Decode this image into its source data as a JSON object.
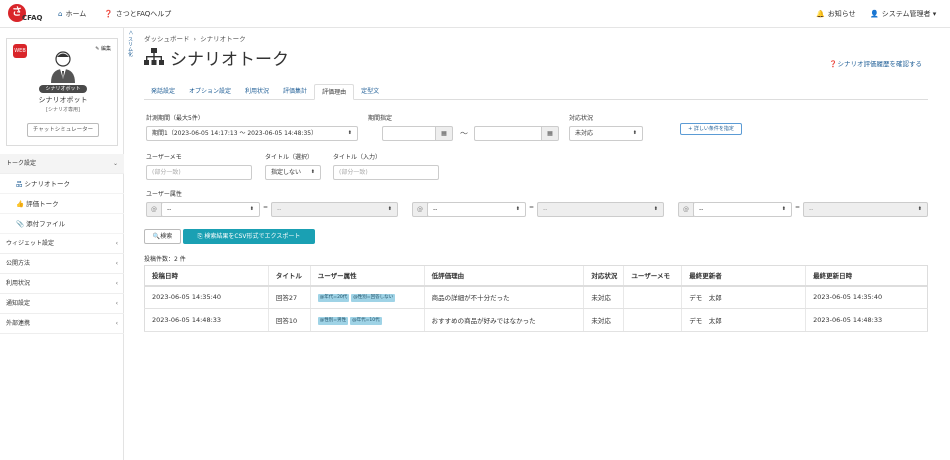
{
  "header": {
    "logo_text": "CFAQ",
    "logo_mark": "さ",
    "home_label": "ホーム",
    "help_label": "さつとFAQヘルプ",
    "notice_label": "お知らせ",
    "user_label": "システム管理者"
  },
  "sidebar": {
    "collapse_label": "＜ スリム化",
    "profile": {
      "web_badge": "WEB",
      "edit_label": "編集",
      "tag": "シナリオボット",
      "name": "シナリオボット",
      "sub": "[シナリオ専用]",
      "simulator_label": "チャットシミュレーター"
    },
    "menu": [
      {
        "label": "トーク設定",
        "open": true
      },
      {
        "label": "ウィジェット設定"
      },
      {
        "label": "公開方法"
      },
      {
        "label": "利用状況"
      },
      {
        "label": "通知設定"
      },
      {
        "label": "外部連携"
      }
    ],
    "submenu": [
      {
        "label": "シナリオトーク"
      },
      {
        "label": "評価トーク"
      },
      {
        "label": "添付ファイル"
      }
    ]
  },
  "breadcrumb": {
    "root": "ダッシュボード",
    "current": "シナリオトーク"
  },
  "page": {
    "title": "シナリオトーク",
    "history_link": "シナリオ評価履歴を確認する"
  },
  "tabs": [
    "発話設定",
    "オプション設定",
    "利用状況",
    "評価集計",
    "評価理由",
    "定型文"
  ],
  "active_tab": "評価理由",
  "filters": {
    "period_label": "計測期間（最大5件）",
    "period_value": "期間1（2023-06-05 14:17:13 〜 2023-06-05 14:48:35）",
    "range_label": "期間指定",
    "range_tilde": "〜",
    "status_label": "対応状況",
    "status_value": "未対応",
    "detail_button": "+ 詳しい条件を指定",
    "memo_label": "ユーザーメモ",
    "memo_placeholder": "(部分一致)",
    "title_select_label": "タイトル（選択）",
    "title_select_value": "指定しない",
    "title_input_label": "タイトル（入力）",
    "title_input_placeholder": "(部分一致)",
    "attr_label": "ユーザー属性",
    "attr_select_value": "--",
    "attr_eq": "=",
    "attr_value_placeholder": "--"
  },
  "actions": {
    "search_label": "検索",
    "export_label": "検索結果をCSV形式でエクスポート"
  },
  "result_count": "投稿件数：2 件",
  "table": {
    "headers": [
      "投稿日時",
      "タイトル",
      "ユーザー属性",
      "低評価理由",
      "対応状況",
      "ユーザーメモ",
      "最終更新者",
      "最終更新日時"
    ],
    "rows": [
      {
        "date": "2023-06-05 14:35:40",
        "title": "回答27",
        "attrs": [
          "@年代=20代",
          "@性別=回答しない"
        ],
        "reason": "商品の詳細が不十分だった",
        "status": "未対応",
        "memo": "",
        "updater": "デモ　太郎",
        "updated": "2023-06-05 14:35:40"
      },
      {
        "date": "2023-06-05 14:48:33",
        "title": "回答10",
        "attrs": [
          "@性別=男性",
          "@年代=10代"
        ],
        "reason": "おすすめの商品が好みではなかった",
        "status": "未対応",
        "memo": "",
        "updater": "デモ　太郎",
        "updated": "2023-06-05 14:48:33"
      }
    ]
  }
}
